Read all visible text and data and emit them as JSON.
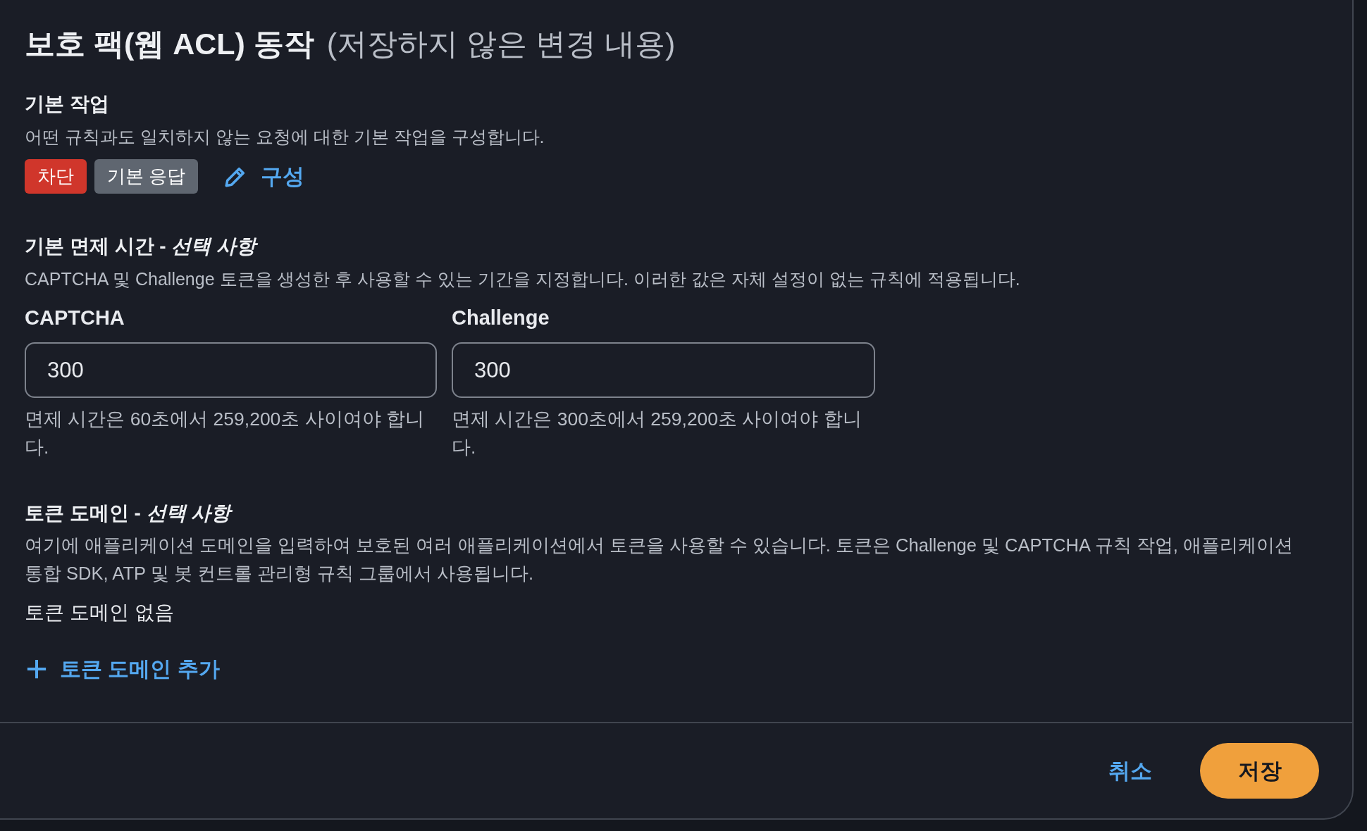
{
  "title": {
    "text": "보호 팩(웹 ACL) 동작",
    "note": "(저장하지 않은 변경 내용)"
  },
  "default_action": {
    "heading": "기본 작업",
    "description": "어떤 규칙과도 일치하지 않는 요청에 대한 기본 작업을 구성합니다.",
    "badges": [
      {
        "label": "차단",
        "color": "#d0362b"
      },
      {
        "label": "기본 응답",
        "color": "#5f6670"
      }
    ],
    "edit_link": "구성"
  },
  "immunity_time": {
    "heading": "기본 면제 시간 - *선택 사항*",
    "description": "CAPTCHA 및 Challenge 토큰을 생성한 후 사용할 수 있는 기간을 지정합니다. 이러한 값은 자체 설정이 없는 규칙에 적용됩니다.",
    "fields": [
      {
        "label": "CAPTCHA",
        "value": "300",
        "hint": "면제 시간은 60초에서 259,200초 사이여야 합니다."
      },
      {
        "label": "Challenge",
        "value": "300",
        "hint": "면제 시간은 300초에서 259,200초 사이여야 합니다."
      }
    ]
  },
  "token_domain": {
    "heading": "토큰 도메인 - *선택 사항*",
    "description": "여기에 애플리케이션 도메인을 입력하여 보호된 여러 애플리케이션에서 토큰을 사용할 수 있습니다. 토큰은 Challenge 및 CAPTCHA 규칙 작업, 애플리케이션 통합 SDK, ATP 및 봇 컨트롤 관리형 규칙 그룹에서 사용됩니다.",
    "empty_text": "토큰 도메인 없음",
    "add_button": "토큰 도메인 추가"
  },
  "footer": {
    "buttons": [
      {
        "label": "취소",
        "kind": "link"
      },
      {
        "label": "저장",
        "kind": "primary"
      }
    ]
  }
}
